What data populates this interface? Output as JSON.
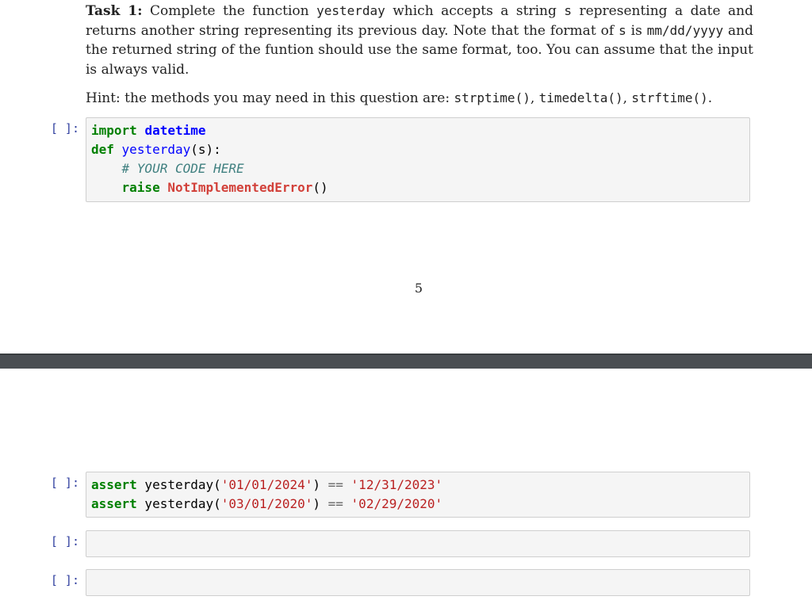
{
  "task": {
    "label": "Task 1:",
    "text_1": " Complete the function ",
    "func_name": "yesterday",
    "text_2": " which accepts a string ",
    "param": "s",
    "text_3": " representing a date and returns another string representing its previous day. Note that the format of ",
    "param_2": "s",
    "text_4": " is ",
    "format": "mm/dd/yyyy",
    "text_5": " and the returned string of the funtion should use the same format, too. You can assume that the input is always valid."
  },
  "hint": {
    "prefix": "Hint: the methods you may need in this question are: ",
    "m1": "strptime()",
    "sep1": ", ",
    "m2": "timedelta()",
    "sep2": ", ",
    "m3": "strftime()",
    "suffix": "."
  },
  "prompt_label": "[ ]:",
  "cell1": {
    "kw_import": "import",
    "mod": "datetime",
    "kw_def": "def",
    "func": "yesterday",
    "args": "(s):",
    "indent": "    ",
    "comment": "# YOUR CODE HERE",
    "kw_raise": "raise",
    "exc": "NotImplementedError",
    "call": "()"
  },
  "page_number": "5",
  "cell2": {
    "line1": {
      "kw": "assert",
      "call": " yesterday(",
      "arg": "'01/01/2024'",
      "close": ")",
      "op": "==",
      "expected": "'12/31/2023'"
    },
    "line2": {
      "kw": "assert",
      "call": " yesterday(",
      "arg": "'03/01/2020'",
      "close": ")",
      "op": "==",
      "expected": "'02/29/2020'"
    }
  }
}
